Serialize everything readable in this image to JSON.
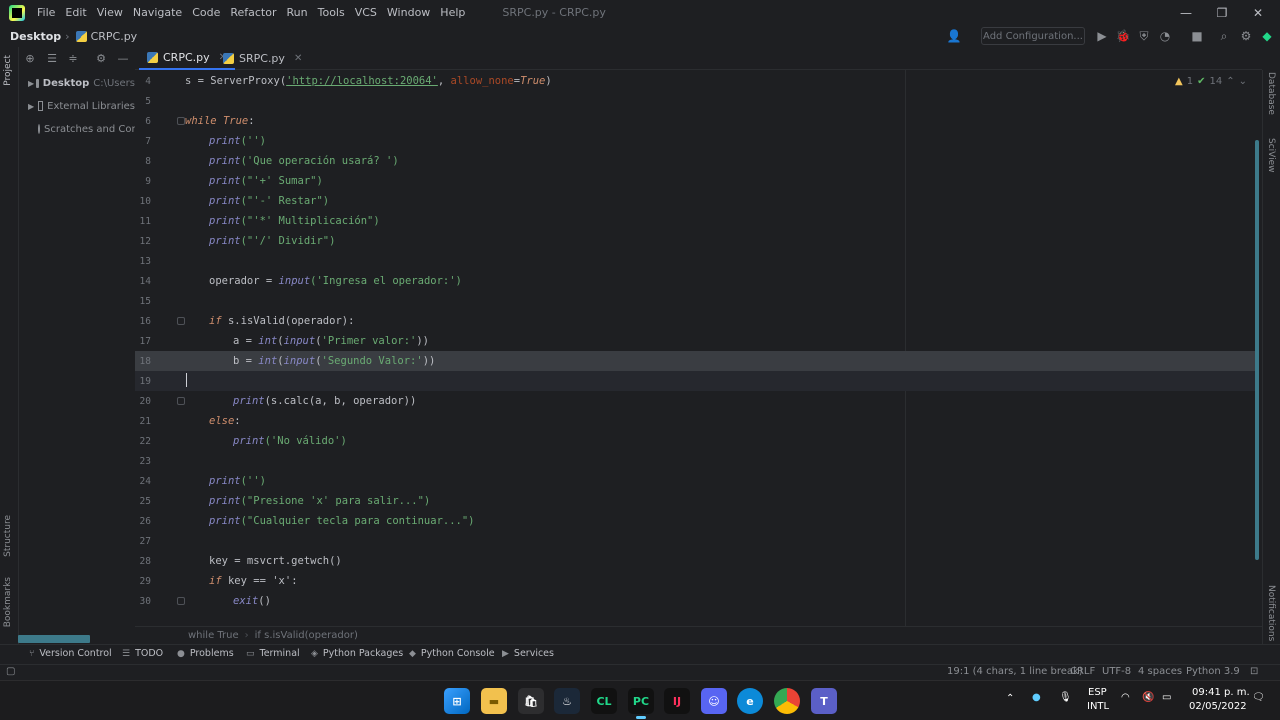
{
  "window": {
    "menus": [
      "File",
      "Edit",
      "View",
      "Navigate",
      "Code",
      "Refactor",
      "Run",
      "Tools",
      "VCS",
      "Window",
      "Help"
    ],
    "title": "SRPC.py - CRPC.py",
    "minimize": "—",
    "maximize": "❐",
    "close": "✕"
  },
  "navbar": {
    "root": "Desktop",
    "file": "CRPC.py",
    "add_config": "Add Configuration..."
  },
  "project_panel": {
    "side_label": "Project",
    "tree": [
      {
        "name": "Desktop",
        "detail": "C:\\Users"
      },
      {
        "name": "External Libraries"
      },
      {
        "name": "Scratches and Con"
      }
    ]
  },
  "tabs": [
    {
      "label": "CRPC.py",
      "close": "✕"
    },
    {
      "label": "SRPC.py",
      "close": "✕"
    }
  ],
  "editor": {
    "inspection_count": "1",
    "check_count": "14",
    "lines": [
      4,
      5,
      6,
      7,
      8,
      9,
      10,
      11,
      12,
      13,
      14,
      15,
      16,
      17,
      18,
      19,
      20,
      21,
      22,
      23,
      24,
      25,
      26,
      27,
      28,
      29,
      30
    ]
  },
  "code": {
    "l4_a": "s = ServerProxy(",
    "l4_url": "'http://localhost:20064'",
    "l4_b": ", ",
    "l4_param": "allow_none",
    "l4_c": "=",
    "l4_true": "True",
    "l4_d": ")",
    "l6_kw": "while",
    "l6_true": "True",
    "l6_colon": ":",
    "print": "print",
    "l7_arg": "('')",
    "l8_arg": "('Que operación usará? ')",
    "l9_arg": "(\"'+' Sumar\")",
    "l10_arg": "(\"'-' Restar\")",
    "l11_arg": "(\"'*' Multiplicación\")",
    "l12_arg": "(\"'/' Dividir\")",
    "l14_var": "operador = ",
    "input": "input",
    "l14_arg": "('Ingresa el operador:')",
    "if": "if",
    "l16_rest": "s.isValid(operador):",
    "l17_a": "a = ",
    "int": "int",
    "l17_arg": "('Primer valor:'))",
    "l18_a": "b = ",
    "l18_arg": "('Segundo Valor:'))",
    "l20_arg": "(s.calc(a, b, operador))",
    "else": "else",
    "l22_arg": "('No válido')",
    "l24_arg": "('')",
    "l25_arg": "(\"Presione 'x' para salir...\")",
    "l26_arg": "(\"Cualquier tecla para continuar...\")",
    "l28": "key = msvcrt.getwch()",
    "l29_rest": "key == 'x':",
    "exit": "exit",
    "l30_arg": "()",
    "open_paren": "(",
    "l17_str": "'Primer valor:'",
    "l17_close": "))",
    "l18_str": "'Segundo Valor:'",
    "l18_close": "))"
  },
  "breadcrumb": [
    "while True",
    "if s.isValid(operador)"
  ],
  "tool_windows": [
    "Version Control",
    "TODO",
    "Problems",
    "Terminal",
    "Python Packages",
    "Python Console",
    "Services"
  ],
  "right_tools": [
    "Database",
    "SciView",
    "Notifications"
  ],
  "left_tools": [
    "Structure",
    "Bookmarks"
  ],
  "status": {
    "position": "19:1 (4 chars, 1 line break)",
    "line_sep": "CRLF",
    "encoding": "UTF-8",
    "indent": "4 spaces",
    "interpreter": "Python 3.9"
  },
  "taskbar": {
    "lang": "ESP",
    "layout": "INTL",
    "time": "09:41 p. m.",
    "date": "02/05/2022"
  },
  "colors": {
    "accent": "#3574f0",
    "keyword": "#cf8e6d",
    "string": "#6aab73"
  }
}
